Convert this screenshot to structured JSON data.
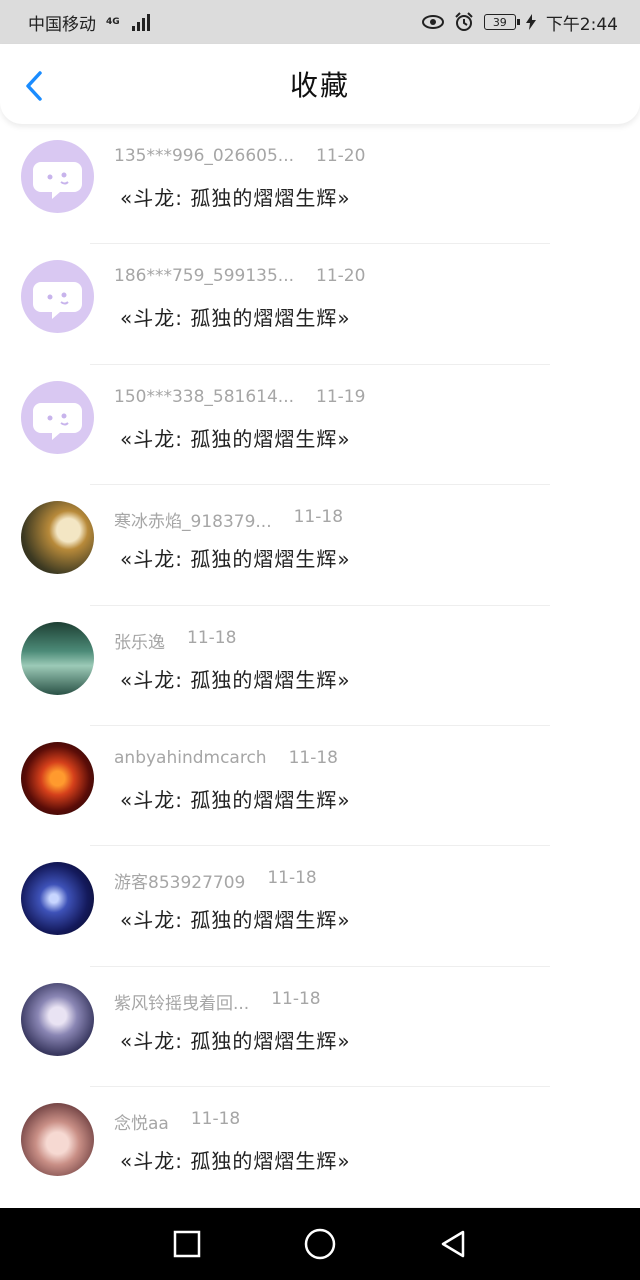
{
  "status_bar": {
    "carrier": "中国移动",
    "network": "4G",
    "battery": "39",
    "time": "下午2:44"
  },
  "header": {
    "title": "收藏",
    "back_icon": "chevron-left-icon",
    "accent": "#1a8cff"
  },
  "items": [
    {
      "username": "135***996_026605...",
      "date": "11-20",
      "text": "«斗龙: 孤独的熠熠生辉»",
      "avatar": "default-chat-avatar"
    },
    {
      "username": "186***759_599135...",
      "date": "11-20",
      "text": "«斗龙: 孤独的熠熠生辉»",
      "avatar": "default-chat-avatar"
    },
    {
      "username": "150***338_581614...",
      "date": "11-19",
      "text": "«斗龙: 孤独的熠熠生辉»",
      "avatar": "default-chat-avatar"
    },
    {
      "username": "寒冰赤焰_918379...",
      "date": "11-18",
      "text": "«斗龙: 孤独的熠熠生辉»",
      "avatar": "photo-avatar-anime-boy"
    },
    {
      "username": "张乐逸",
      "date": "11-18",
      "text": "«斗龙: 孤独的熠熠生辉»",
      "avatar": "photo-avatar-landscape"
    },
    {
      "username": "anbyahindmcarch",
      "date": "11-18",
      "text": "«斗龙: 孤独的熠熠生辉»",
      "avatar": "photo-avatar-fire-y"
    },
    {
      "username": "游客853927709",
      "date": "11-18",
      "text": "«斗龙: 孤独的熠熠生辉»",
      "avatar": "photo-avatar-dark-blue"
    },
    {
      "username": "紫风铃摇曳着回...",
      "date": "11-18",
      "text": "«斗龙: 孤独的熠熠生辉»",
      "avatar": "photo-avatar-anime-girl"
    },
    {
      "username": "念悦aa",
      "date": "11-18",
      "text": "«斗龙: 孤独的熠熠生辉»",
      "avatar": "photo-avatar-anime-pink"
    }
  ],
  "nav": {
    "recent_icon": "square-icon",
    "home_icon": "circle-icon",
    "back_icon": "triangle-back-icon"
  }
}
